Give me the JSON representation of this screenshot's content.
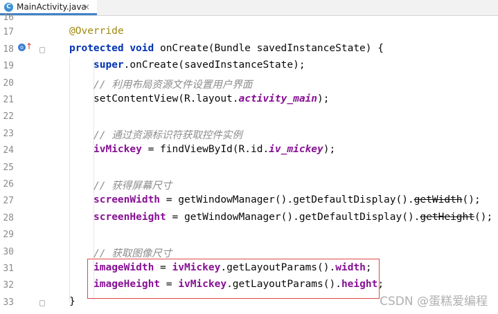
{
  "tab": {
    "icon": "C",
    "filename": "MainActivity.java",
    "close": "×"
  },
  "line_numbers": [
    "16",
    "17",
    "18",
    "19",
    "20",
    "21",
    "22",
    "23",
    "24",
    "25",
    "26",
    "27",
    "28",
    "29",
    "30",
    "31",
    "32",
    "33"
  ],
  "code": {
    "l17": {
      "t1": "@Override"
    },
    "l18": {
      "t1": "protected",
      "t2": " ",
      "t3": "void",
      "t4": " onCreate(Bundle savedInstanceState) {"
    },
    "l19": {
      "t1": "super",
      "t2": ".onCreate(savedInstanceState);"
    },
    "l20": {
      "t1": "// 利用布局资源文件设置用户界面"
    },
    "l21": {
      "t1": "setContentView(R.layout.",
      "t2": "activity_main",
      "t3": ");"
    },
    "l23": {
      "t1": "// 通过资源标识符获取控件实例"
    },
    "l24": {
      "t1": "ivMickey",
      "t2": " = findViewById(R.id.",
      "t3": "iv_mickey",
      "t4": ");"
    },
    "l26": {
      "t1": "// 获得屏幕尺寸"
    },
    "l27": {
      "t1": "screenWidth",
      "t2": " = getWindowManager().getDefaultDisplay().",
      "t3": "getWidth",
      "t4": "();"
    },
    "l28": {
      "t1": "screenHeight",
      "t2": " = getWindowManager().getDefaultDisplay().",
      "t3": "getHeight",
      "t4": "();"
    },
    "l30": {
      "t1": "// 获取图像尺寸"
    },
    "l31": {
      "t1": "imageWidth",
      "t2": " = ",
      "t3": "ivMickey",
      "t4": ".getLayoutParams().",
      "t5": "width",
      "t6": ";"
    },
    "l32": {
      "t1": "imageHeight",
      "t2": " = ",
      "t3": "ivMickey",
      "t4": ".getLayoutParams().",
      "t5": "height",
      "t6": ";"
    },
    "l33": {
      "t1": "}"
    }
  },
  "watermark": "CSDN @蛋糕爱编程",
  "colors": {
    "keyword": "#0033b3",
    "field": "#871094",
    "comment": "#8c8c8c",
    "annotation": "#9e880d",
    "highlight": "#e04646"
  }
}
